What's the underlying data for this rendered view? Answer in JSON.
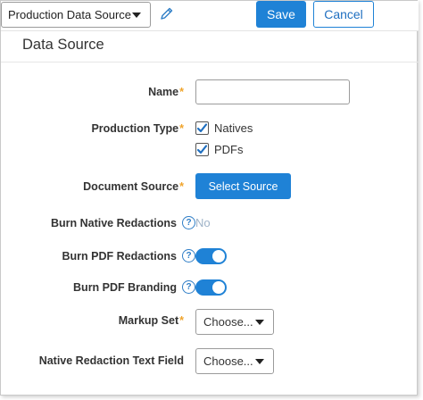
{
  "toolbar": {
    "data_source_select": "Production Data Source",
    "edit_icon": "pencil-icon",
    "save_label": "Save",
    "cancel_label": "Cancel"
  },
  "section": {
    "title": "Data Source"
  },
  "form": {
    "name": {
      "label": "Name",
      "required_mark": "*",
      "value": ""
    },
    "production_type": {
      "label": "Production Type",
      "required_mark": "*",
      "options": [
        {
          "label": "Natives",
          "checked": true
        },
        {
          "label": "PDFs",
          "checked": true
        }
      ]
    },
    "document_source": {
      "label": "Document Source",
      "required_mark": "*",
      "button_label": "Select Source"
    },
    "burn_native_redactions": {
      "label": "Burn Native Redactions",
      "help": "?",
      "value": "No"
    },
    "burn_pdf_redactions": {
      "label": "Burn PDF Redactions",
      "help": "?",
      "enabled": true
    },
    "burn_pdf_branding": {
      "label": "Burn PDF Branding",
      "help": "?",
      "enabled": true
    },
    "markup_set": {
      "label": "Markup Set",
      "required_mark": "*",
      "value": "Choose..."
    },
    "native_redaction_text_field": {
      "label": "Native Redaction Text Field",
      "value": "Choose..."
    }
  },
  "colors": {
    "primary": "#1f82d6",
    "required": "#f0a42c",
    "muted": "#9fb3c8"
  }
}
